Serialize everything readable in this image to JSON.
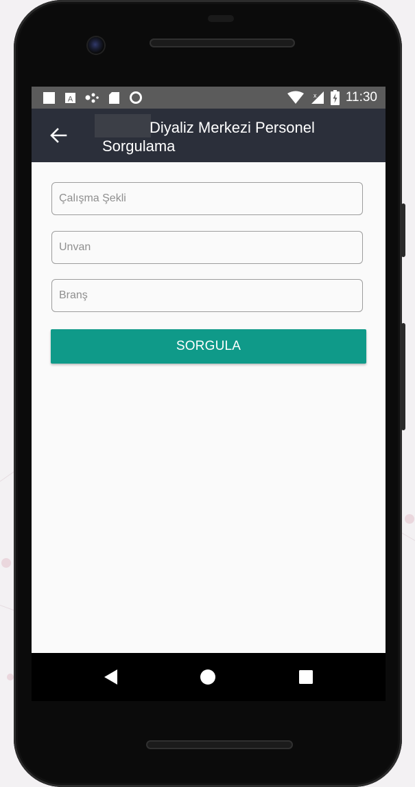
{
  "status_bar": {
    "time": "11:30",
    "notification_icons": [
      "square-icon",
      "a-box-icon",
      "dots-icon",
      "sd-card-icon",
      "ring-icon"
    ],
    "system_icons": [
      "wifi-icon",
      "cellular-icon",
      "battery-charging-icon"
    ]
  },
  "app_bar": {
    "title_line1": "Diyaliz Merkezi Personel",
    "title_line2": "Sorgulama",
    "back_icon": "arrow-back-icon",
    "background_color": "#2b2f3a"
  },
  "form": {
    "fields": [
      {
        "placeholder": "Çalışma Şekli",
        "value": ""
      },
      {
        "placeholder": "Unvan",
        "value": ""
      },
      {
        "placeholder": "Branş",
        "value": ""
      }
    ],
    "submit_label": "SORGULA",
    "submit_color": "#0f9a89"
  },
  "nav_bar": {
    "icons": [
      "nav-back-icon",
      "nav-home-icon",
      "nav-recents-icon"
    ]
  }
}
